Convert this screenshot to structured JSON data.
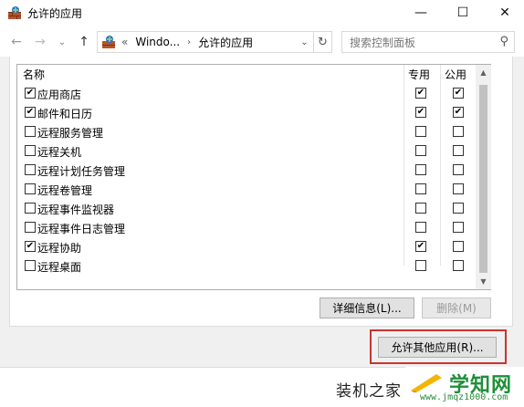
{
  "window": {
    "title": "允许的应用",
    "minimize_glyph": "—",
    "maximize_glyph": "☐",
    "close_glyph": "✕"
  },
  "nav": {
    "back_icon": "arrow-left",
    "forward_icon": "arrow-right",
    "recent_icon": "chevron-down",
    "up_icon": "arrow-up",
    "address_prefix": "«",
    "address_segments": [
      "Windo...",
      "允许的应用"
    ],
    "search_placeholder": "搜索控制面板"
  },
  "list": {
    "columns": {
      "name": "名称",
      "private": "专用",
      "public": "公用"
    },
    "rows": [
      {
        "name": "应用商店",
        "enabled": true,
        "private": true,
        "public": true
      },
      {
        "name": "邮件和日历",
        "enabled": true,
        "private": true,
        "public": true
      },
      {
        "name": "远程服务管理",
        "enabled": false,
        "private": false,
        "public": false
      },
      {
        "name": "远程关机",
        "enabled": false,
        "private": false,
        "public": false
      },
      {
        "name": "远程计划任务管理",
        "enabled": false,
        "private": false,
        "public": false
      },
      {
        "name": "远程卷管理",
        "enabled": false,
        "private": false,
        "public": false
      },
      {
        "name": "远程事件监视器",
        "enabled": false,
        "private": false,
        "public": false
      },
      {
        "name": "远程事件日志管理",
        "enabled": false,
        "private": false,
        "public": false
      },
      {
        "name": "远程协助",
        "enabled": true,
        "private": true,
        "public": false
      },
      {
        "name": "远程桌面",
        "enabled": false,
        "private": false,
        "public": false
      }
    ]
  },
  "buttons": {
    "details": "详细信息(L)...",
    "remove": "删除(M)",
    "allow_other": "允许其他应用(R)..."
  },
  "watermark": {
    "left_text": "装机之家",
    "title": "学知网",
    "url": "www.jmqz1000.com"
  },
  "colors": {
    "highlight": "#c8342e",
    "watermark_green": "#1f8f3a"
  }
}
